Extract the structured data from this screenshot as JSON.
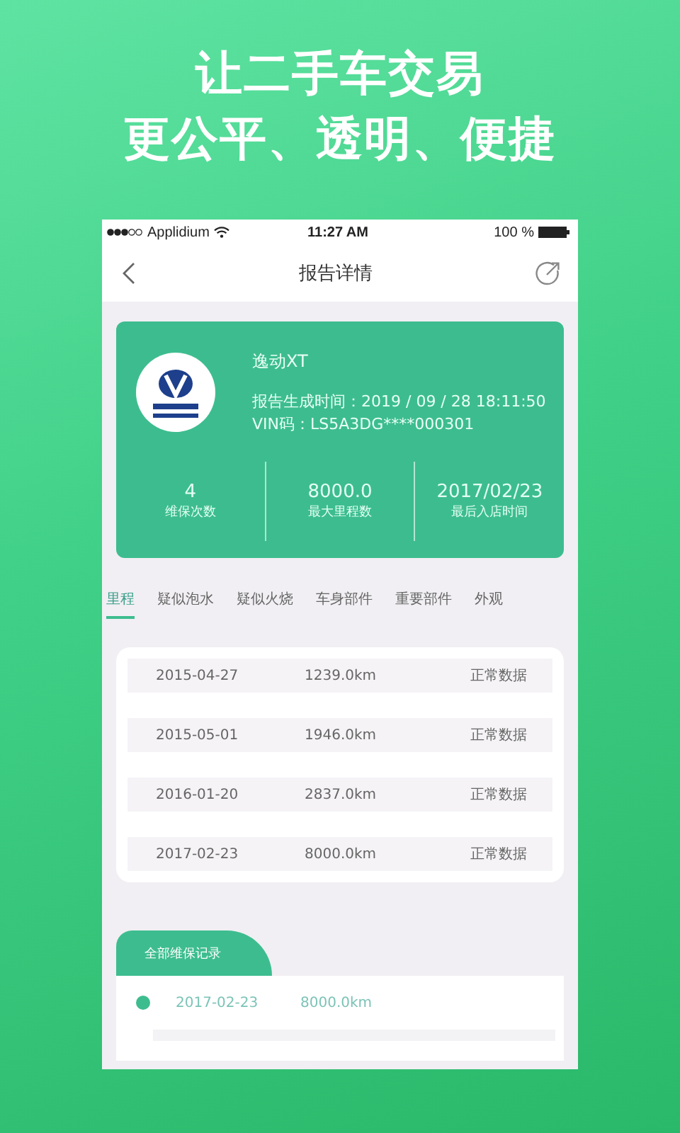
{
  "headline": [
    "让二手车交易",
    "更公平、透明、便捷"
  ],
  "status_bar": {
    "carrier": "Applidium",
    "time": "11:27 AM",
    "battery": "100 %"
  },
  "nav": {
    "title": "报告详情"
  },
  "car": {
    "name": "逸动XT",
    "report_time": "报告生成时间：2019 / 09 / 28 18:11:50",
    "vin": "VIN码：LS5A3DG****000301",
    "stats": [
      {
        "value": "4",
        "label": "维保次数"
      },
      {
        "value": "8000.0",
        "label": "最大里程数"
      },
      {
        "value": "2017/02/23",
        "label": "最后入店时间"
      }
    ]
  },
  "tabs": [
    {
      "label": "里程",
      "selected": true
    },
    {
      "label": "疑似泡水",
      "selected": false
    },
    {
      "label": "疑似火烧",
      "selected": false
    },
    {
      "label": "车身部件",
      "selected": false
    },
    {
      "label": "重要部件",
      "selected": false
    },
    {
      "label": "外观",
      "selected": false
    }
  ],
  "mileage_rows": [
    {
      "date": "2015-04-27",
      "mileage": "1239.0km",
      "status": "正常数据"
    },
    {
      "date": "2015-05-01",
      "mileage": "1946.0km",
      "status": "正常数据"
    },
    {
      "date": "2016-01-20",
      "mileage": "2837.0km",
      "status": "正常数据"
    },
    {
      "date": "2017-02-23",
      "mileage": "8000.0km",
      "status": "正常数据"
    }
  ],
  "records": {
    "title": "全部维保记录",
    "items": [
      {
        "date": "2017-02-23",
        "mileage": "8000.0km"
      }
    ]
  }
}
